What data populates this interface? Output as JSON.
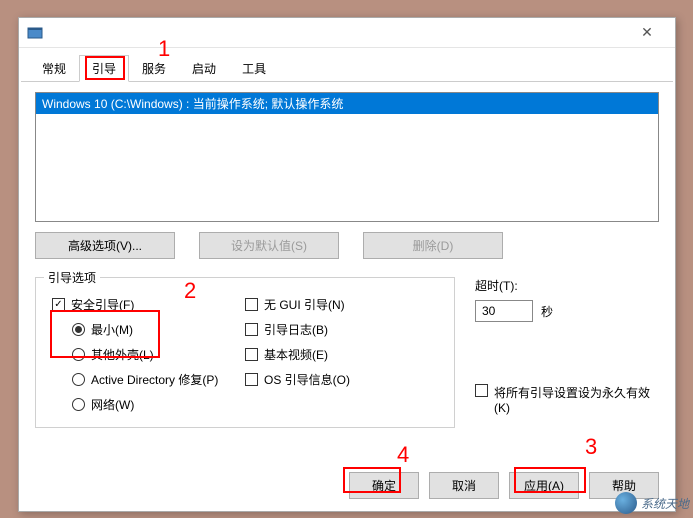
{
  "tabs": {
    "general": "常规",
    "boot": "引导",
    "services": "服务",
    "startup": "启动",
    "tools": "工具"
  },
  "listbox": {
    "item0": "Windows 10 (C:\\Windows) : 当前操作系统; 默认操作系统"
  },
  "buttons": {
    "advanced": "高级选项(V)...",
    "setdefault": "设为默认值(S)",
    "delete": "删除(D)"
  },
  "bootoptions": {
    "group_title": "引导选项",
    "safeboot": "安全引导(F)",
    "minimal": "最小(M)",
    "altshell": "其他外壳(L)",
    "adrepair": "Active Directory 修复(P)",
    "network": "网络(W)",
    "nogui": "无 GUI 引导(N)",
    "bootlog": "引导日志(B)",
    "basevideo": "基本视频(E)",
    "osbootinfo": "OS 引导信息(O)"
  },
  "timeout": {
    "label": "超时(T):",
    "value": "30",
    "unit": "秒"
  },
  "permanent": {
    "label": "将所有引导设置设为永久有效(K)"
  },
  "dialog_buttons": {
    "ok": "确定",
    "cancel": "取消",
    "apply": "应用(A)",
    "help": "帮助"
  },
  "annotations": {
    "n1": "1",
    "n2": "2",
    "n3": "3",
    "n4": "4"
  },
  "watermark": {
    "text": "系统天地"
  }
}
